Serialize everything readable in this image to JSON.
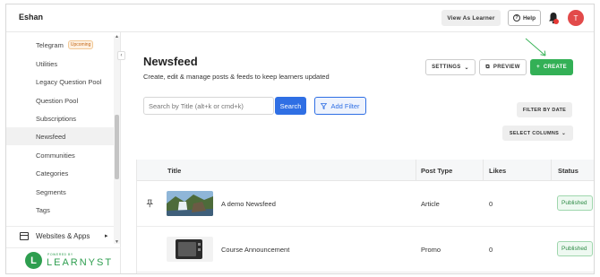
{
  "topbar": {
    "brand": "Eshan",
    "view_as_learner": "View As Learner",
    "help": "Help",
    "avatar_initial": "T"
  },
  "sidebar": {
    "items": [
      {
        "label": "Telegram",
        "tag": "Upcoming"
      },
      {
        "label": "Utilities"
      },
      {
        "label": "Legacy Question Pool"
      },
      {
        "label": "Question Pool"
      },
      {
        "label": "Subscriptions"
      },
      {
        "label": "Newsfeed",
        "active": true
      },
      {
        "label": "Communities"
      },
      {
        "label": "Categories"
      },
      {
        "label": "Segments"
      },
      {
        "label": "Tags"
      }
    ],
    "websites_label": "Websites & Apps",
    "powered_by": "POWERED BY",
    "logo_letter": "L",
    "logo_text": "LEARNYST"
  },
  "main": {
    "title": "Newsfeed",
    "subtitle": "Create, edit & manage posts & feeds to keep learners updated",
    "settings_label": "SETTINGS",
    "preview_label": "PREVIEW",
    "create_label": "CREATE",
    "search_placeholder": "Search by Title (alt+k or cmd+k)",
    "search_button": "Search",
    "add_filter": "Add Filter",
    "filter_by_date": "FILTER BY DATE",
    "select_columns": "SELECT COLUMNS"
  },
  "table": {
    "headers": {
      "title": "Title",
      "post_type": "Post Type",
      "likes": "Likes",
      "status": "Status"
    },
    "rows": [
      {
        "title": "A demo Newsfeed",
        "post_type": "Article",
        "likes": "0",
        "status": "Published",
        "pinned": true
      },
      {
        "title": "Course Announcement",
        "post_type": "Promo",
        "likes": "0",
        "status": "Published",
        "pinned": false
      }
    ]
  },
  "colors": {
    "accent_green": "#33b056",
    "primary_blue": "#2f6fe4",
    "avatar_red": "#e24a4a"
  }
}
